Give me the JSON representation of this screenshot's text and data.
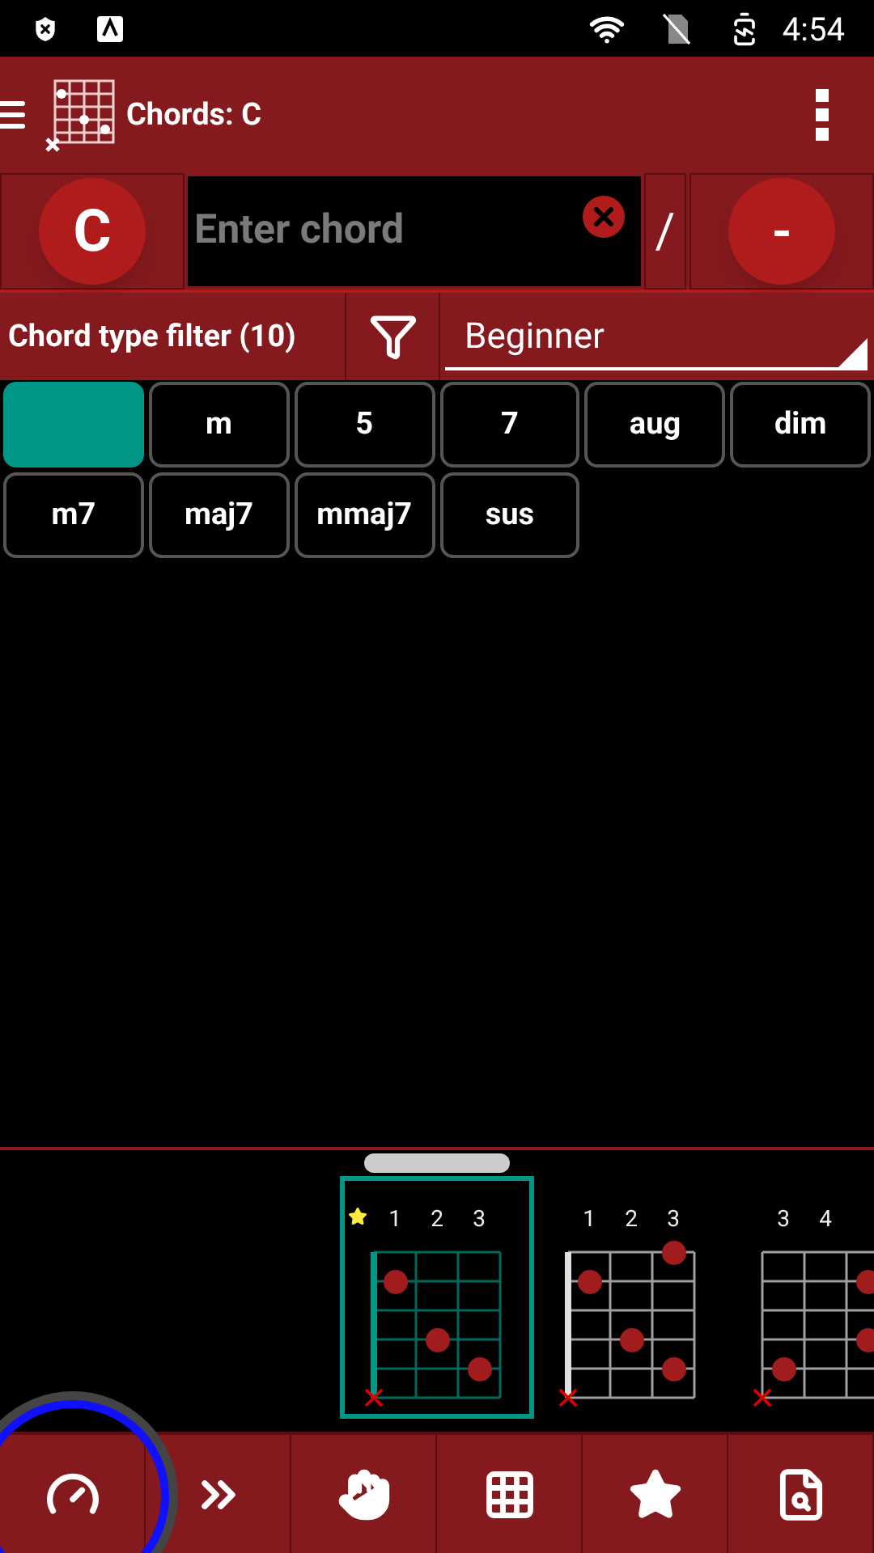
{
  "status_bar": {
    "time": "4:54"
  },
  "toolbar": {
    "title": "Chords: C"
  },
  "chord_input": {
    "root": "C",
    "placeholder": "Enter chord",
    "separator": "/",
    "bass": "-"
  },
  "filter": {
    "label": "Chord type filter (10)",
    "level_select": "Beginner"
  },
  "chord_types": [
    {
      "selected": true
    },
    {
      "label": "m",
      "selected": false
    },
    {
      "label": "5",
      "selected": false
    },
    {
      "label": "7",
      "selected": false
    },
    {
      "label": "aug",
      "selected": false
    },
    {
      "label": "dim",
      "selected": false
    },
    {
      "label": "m7",
      "selected": false
    },
    {
      "label": "maj7",
      "selected": false
    },
    {
      "label": "mmaj7",
      "selected": false
    },
    {
      "label": "sus",
      "selected": false
    }
  ],
  "diagrams": [
    {
      "selected": true,
      "favorite": true,
      "nut": true,
      "frets": [
        "1",
        "2",
        "3"
      ],
      "strings": [
        {
          "muted": false,
          "cells": [
            {
              "dot": false
            },
            {
              "dot": false
            },
            {
              "dot": false
            }
          ]
        },
        {
          "muted": false,
          "cells": [
            {
              "dot": true
            },
            {
              "dot": false
            },
            {
              "dot": false
            }
          ]
        },
        {
          "muted": false,
          "cells": [
            {
              "dot": false
            },
            {
              "dot": false
            },
            {
              "dot": false
            }
          ]
        },
        {
          "muted": false,
          "cells": [
            {
              "dot": false
            },
            {
              "dot": true
            },
            {
              "dot": false
            }
          ]
        },
        {
          "muted": false,
          "cells": [
            {
              "dot": false
            },
            {
              "dot": false
            },
            {
              "dot": true
            }
          ]
        },
        {
          "muted": true,
          "cells": [
            {
              "dot": false
            },
            {
              "dot": false
            },
            {
              "dot": false
            }
          ]
        }
      ]
    },
    {
      "selected": false,
      "favorite": false,
      "nut": true,
      "frets": [
        "1",
        "2",
        "3"
      ],
      "strings": [
        {
          "muted": false,
          "cells": [
            {
              "dot": false
            },
            {
              "dot": false
            },
            {
              "dot": true
            }
          ]
        },
        {
          "muted": false,
          "cells": [
            {
              "dot": true
            },
            {
              "dot": false
            },
            {
              "dot": false
            }
          ]
        },
        {
          "muted": false,
          "cells": [
            {
              "dot": false
            },
            {
              "dot": false
            },
            {
              "dot": false
            }
          ]
        },
        {
          "muted": false,
          "cells": [
            {
              "dot": false
            },
            {
              "dot": true
            },
            {
              "dot": false
            }
          ]
        },
        {
          "muted": false,
          "cells": [
            {
              "dot": false
            },
            {
              "dot": false
            },
            {
              "dot": true
            }
          ]
        },
        {
          "muted": true,
          "cells": [
            {
              "dot": false
            },
            {
              "dot": false
            },
            {
              "dot": false
            }
          ]
        }
      ]
    },
    {
      "selected": false,
      "favorite": false,
      "nut": false,
      "frets": [
        "3",
        "4"
      ],
      "strings": [
        {
          "muted": false,
          "cells": [
            {
              "dot": false
            },
            {
              "dot": false
            },
            {
              "dot": false
            }
          ]
        },
        {
          "muted": false,
          "cells": [
            {
              "dot": false
            },
            {
              "dot": false
            },
            {
              "dot": true
            }
          ]
        },
        {
          "muted": false,
          "cells": [
            {
              "dot": false
            },
            {
              "dot": false
            },
            {
              "dot": false
            }
          ]
        },
        {
          "muted": false,
          "cells": [
            {
              "dot": false
            },
            {
              "dot": false
            },
            {
              "dot": true
            }
          ]
        },
        {
          "muted": false,
          "cells": [
            {
              "dot": true
            },
            {
              "dot": false
            },
            {
              "dot": false
            }
          ]
        },
        {
          "muted": true,
          "cells": [
            {
              "dot": false
            },
            {
              "dot": false
            },
            {
              "dot": false
            }
          ]
        }
      ]
    }
  ],
  "bottom_nav": [
    {
      "kind": "tuner",
      "focused": true
    },
    {
      "kind": "progression",
      "focused": false
    },
    {
      "kind": "fingers",
      "focused": false
    },
    {
      "kind": "grid",
      "focused": false
    },
    {
      "kind": "favorites",
      "focused": false
    },
    {
      "kind": "search",
      "focused": false
    }
  ]
}
